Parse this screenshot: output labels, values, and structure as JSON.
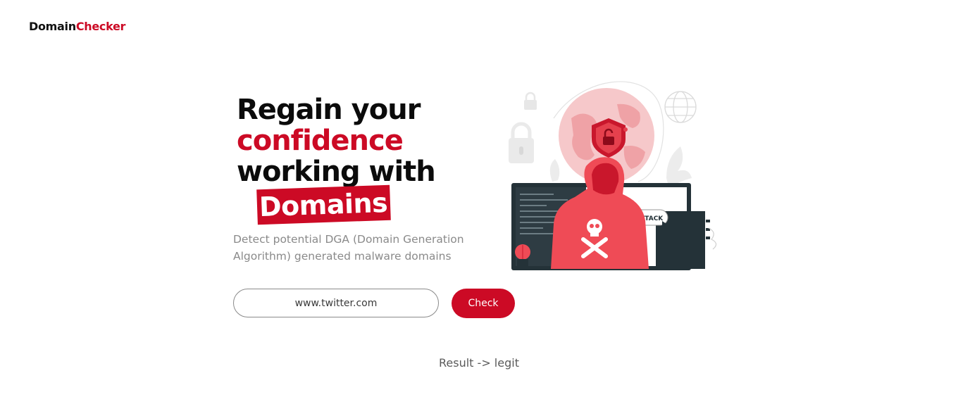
{
  "header": {
    "logo_part1": "Domain",
    "logo_part2": "Checker"
  },
  "hero": {
    "line1": "Regain your",
    "line2": "confidence",
    "line3": "working with",
    "tag": "Domains",
    "subtitle": "Detect potential DGA (Domain Generation Algorithm) generated malware domains"
  },
  "form": {
    "input_value": "www.twitter.com",
    "button_label": "Check"
  },
  "result": {
    "text": "Result -> legit"
  },
  "illustration": {
    "screen_label": "ATTACK"
  },
  "colors": {
    "accent": "#cc0a25",
    "hood": "#ef4b56",
    "text": "#0b0b0b",
    "muted": "#8a8a8a"
  }
}
